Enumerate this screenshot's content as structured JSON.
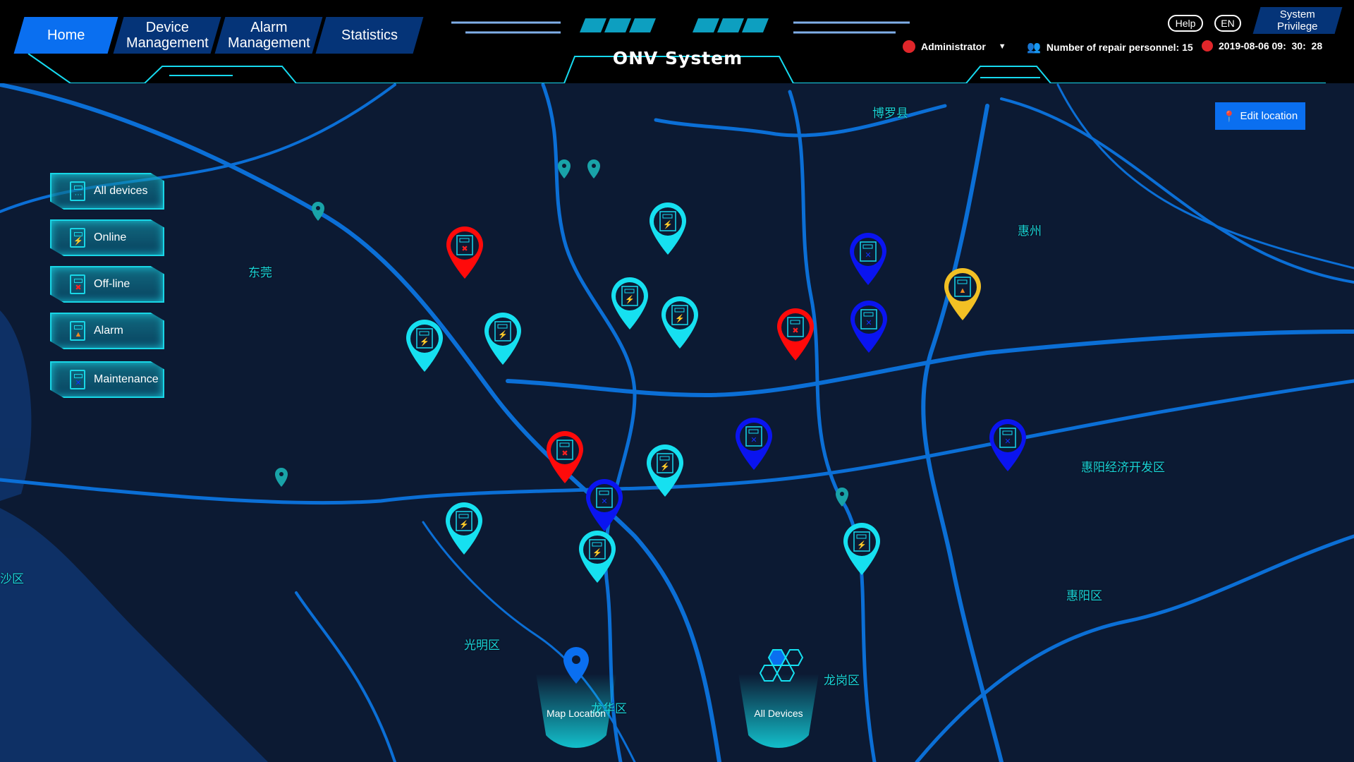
{
  "nav": {
    "tabs": [
      {
        "label": "Home",
        "active": true
      },
      {
        "label": "Device\nManagement"
      },
      {
        "label": "Alarm\nManagement"
      },
      {
        "label": "Statistics"
      }
    ]
  },
  "header": {
    "title": "ONV System",
    "help": "Help",
    "lang": "EN",
    "privilege": "System\nPrivilege",
    "user": "Administrator",
    "repair": "Number of repair personnel: 15",
    "datetime": "2019-08-06 09:  30:  28"
  },
  "edit_location": "Edit location",
  "filters": [
    {
      "label": "All devices",
      "icon": "device-icon"
    },
    {
      "label": "Online",
      "icon": "lightning-icon"
    },
    {
      "label": "Off-line",
      "icon": "offline-x-icon"
    },
    {
      "label": "Alarm",
      "icon": "warning-triangle-icon"
    },
    {
      "label": "Maintenance",
      "icon": "wrench-icon"
    }
  ],
  "map_labels": [
    "博罗县",
    "惠州",
    "东莞",
    "惠阳经济开发区",
    "惠阳区",
    "光明区",
    "龙岗区",
    "龙华区",
    "沙区"
  ],
  "markers": [
    "online",
    "online",
    "online",
    "online",
    "online",
    "online",
    "online",
    "online",
    "online",
    "offline",
    "offline",
    "offline",
    "maintenance",
    "maintenance",
    "maintenance",
    "maintenance",
    "maintenance",
    "alarm"
  ],
  "status_colors": {
    "online": "#16e0f0",
    "offline": "#ff0a0a",
    "maintenance": "#0a14f0",
    "alarm": "#f2c024",
    "poi": "#19a3a8",
    "accent": "#0a6ff0"
  },
  "bottom": {
    "map_location": "Map Location",
    "all_devices": "All Devices"
  }
}
